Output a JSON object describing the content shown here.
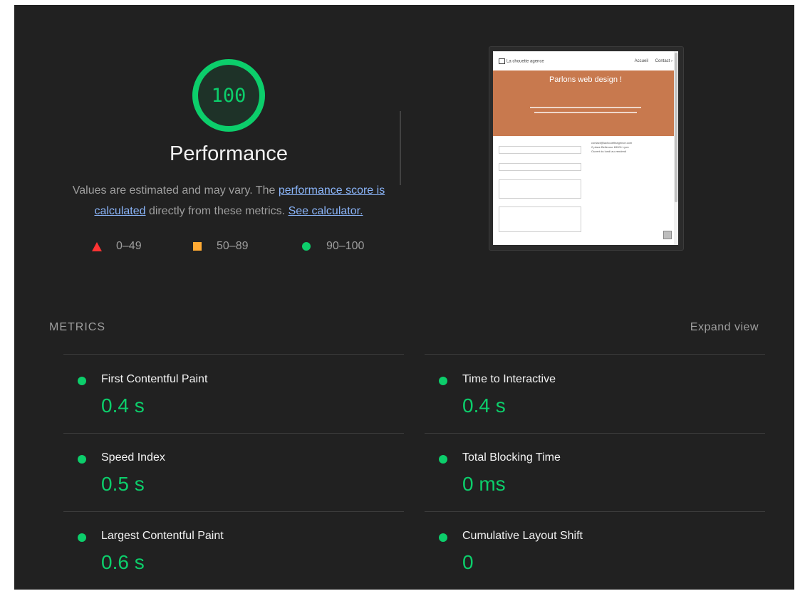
{
  "gauge": {
    "score": "100",
    "score_fraction": 1.0,
    "title": "Performance",
    "color": "#0cce6b"
  },
  "description": {
    "text1": "Values are estimated and may vary. The ",
    "link1": "performance score is calculated",
    "text2": " directly from these metrics. ",
    "link2": "See calculator."
  },
  "legend": {
    "fail": "0–49",
    "average": "50–89",
    "pass": "90–100",
    "fail_color": "#ff3333",
    "average_color": "#ffaa33",
    "pass_color": "#0cce6b"
  },
  "screenshot": {
    "site_name": "La chouette agence",
    "nav_links": [
      "Accueil",
      "Contact ›"
    ],
    "hero_title": "Parlons web design !",
    "hero_color": "#c8794e",
    "contact_lines": [
      "contact@lachouetteagence.com",
      "2 place Bellecour 69001 Lyon",
      "Ouvert du lundi au vendredi"
    ]
  },
  "metrics": {
    "title": "METRICS",
    "expand_label": "Expand view",
    "items": [
      {
        "label": "First Contentful Paint",
        "value": "0.4 s"
      },
      {
        "label": "Time to Interactive",
        "value": "0.4 s"
      },
      {
        "label": "Speed Index",
        "value": "0.5 s"
      },
      {
        "label": "Total Blocking Time",
        "value": "0 ms"
      },
      {
        "label": "Largest Contentful Paint",
        "value": "0.6 s"
      },
      {
        "label": "Cumulative Layout Shift",
        "value": "0"
      }
    ]
  }
}
